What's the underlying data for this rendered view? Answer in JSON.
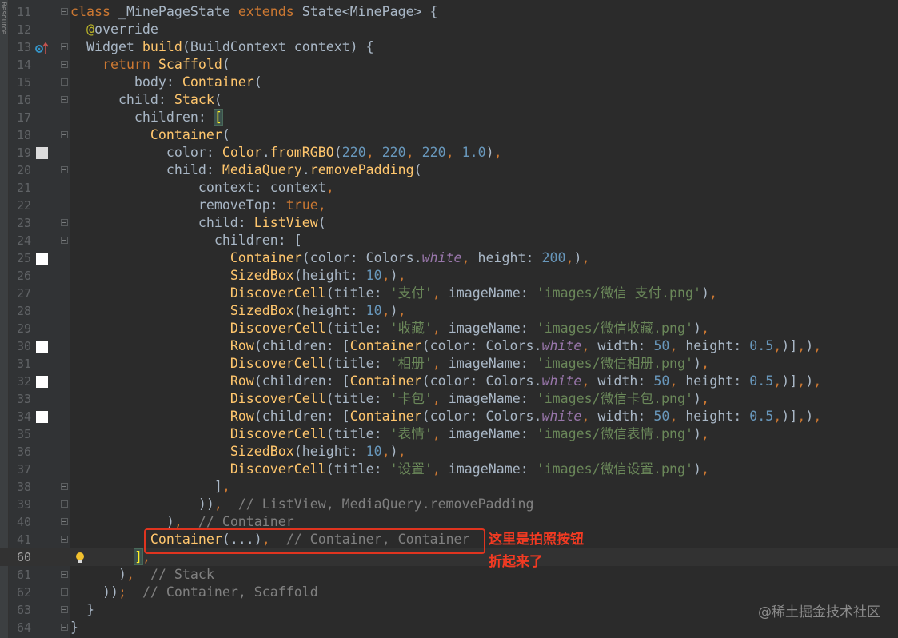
{
  "sidebar": {
    "tool_window_label": "Resource"
  },
  "colors": {
    "background": "#2b2b2b",
    "keyword": "#cc7832",
    "class": "#ffc66d",
    "string": "#6a8759",
    "number": "#6897bb",
    "comment": "#808080",
    "annotation_red": "#e0341f"
  },
  "lines": [
    {
      "n": "11",
      "fold": true,
      "tokens": [
        [
          "k",
          "class "
        ],
        [
          "t",
          "_MinePageState "
        ],
        [
          "k",
          "extends "
        ],
        [
          "t",
          "State<MinePage> {"
        ]
      ]
    },
    {
      "n": "12",
      "tokens": [
        [
          "t",
          "  "
        ],
        [
          "a",
          "@"
        ],
        [
          "t",
          "override"
        ]
      ]
    },
    {
      "n": "13",
      "fold": true,
      "icon": "override-method-icon",
      "tokens": [
        [
          "t",
          "  Widget "
        ],
        [
          "c",
          "build"
        ],
        [
          "t",
          "(BuildContext context) {"
        ]
      ]
    },
    {
      "n": "14",
      "fold": true,
      "tokens": [
        [
          "t",
          "    "
        ],
        [
          "k",
          "return "
        ],
        [
          "c",
          "Scaffold"
        ],
        [
          "t",
          "("
        ]
      ]
    },
    {
      "n": "15",
      "fold": true,
      "tokens": [
        [
          "t",
          "        body: "
        ],
        [
          "c",
          "Container"
        ],
        [
          "t",
          "("
        ]
      ]
    },
    {
      "n": "16",
      "fold": true,
      "tokens": [
        [
          "t",
          "      child: "
        ],
        [
          "c",
          "Stack"
        ],
        [
          "t",
          "("
        ]
      ]
    },
    {
      "n": "17",
      "tokens": [
        [
          "t",
          "        children: "
        ],
        [
          "b",
          "["
        ]
      ]
    },
    {
      "n": "18",
      "fold": true,
      "tokens": [
        [
          "t",
          "          "
        ],
        [
          "c",
          "Container"
        ],
        [
          "t",
          "("
        ]
      ]
    },
    {
      "n": "19",
      "swatch": "#dcdcdc",
      "tokens": [
        [
          "t",
          "            color: "
        ],
        [
          "c",
          "Color"
        ],
        [
          "t",
          "."
        ],
        [
          "c",
          "fromRGBO"
        ],
        [
          "t",
          "("
        ],
        [
          "n",
          "220"
        ],
        [
          "k",
          ", "
        ],
        [
          "n",
          "220"
        ],
        [
          "k",
          ", "
        ],
        [
          "n",
          "220"
        ],
        [
          "k",
          ", "
        ],
        [
          "n",
          "1.0"
        ],
        [
          "t",
          ")"
        ],
        [
          "k",
          ","
        ]
      ]
    },
    {
      "n": "20",
      "fold": true,
      "tokens": [
        [
          "t",
          "            child: "
        ],
        [
          "c",
          "MediaQuery"
        ],
        [
          "t",
          "."
        ],
        [
          "c",
          "removePadding"
        ],
        [
          "t",
          "("
        ]
      ]
    },
    {
      "n": "21",
      "tokens": [
        [
          "t",
          "                context: context"
        ],
        [
          "k",
          ","
        ]
      ]
    },
    {
      "n": "22",
      "tokens": [
        [
          "t",
          "                removeTop: "
        ],
        [
          "k",
          "true,"
        ]
      ]
    },
    {
      "n": "23",
      "fold": true,
      "tokens": [
        [
          "t",
          "                child: "
        ],
        [
          "c",
          "ListView"
        ],
        [
          "t",
          "("
        ]
      ]
    },
    {
      "n": "24",
      "fold": true,
      "tokens": [
        [
          "t",
          "                  children: ["
        ]
      ]
    },
    {
      "n": "25",
      "swatch": "#ffffff",
      "tokens": [
        [
          "t",
          "                    "
        ],
        [
          "c",
          "Container"
        ],
        [
          "t",
          "(color: Colors."
        ],
        [
          "p",
          "white"
        ],
        [
          "k",
          ", "
        ],
        [
          "t",
          "height: "
        ],
        [
          "n",
          "200"
        ],
        [
          "k",
          ","
        ],
        [
          "t",
          ")"
        ],
        [
          "k",
          ","
        ]
      ]
    },
    {
      "n": "26",
      "tokens": [
        [
          "t",
          "                    "
        ],
        [
          "c",
          "SizedBox"
        ],
        [
          "t",
          "(height: "
        ],
        [
          "n",
          "10"
        ],
        [
          "k",
          ","
        ],
        [
          "t",
          ")"
        ],
        [
          "k",
          ","
        ]
      ]
    },
    {
      "n": "27",
      "tokens": [
        [
          "t",
          "                    "
        ],
        [
          "c",
          "DiscoverCell"
        ],
        [
          "t",
          "(title: "
        ],
        [
          "s",
          "'支付'"
        ],
        [
          "k",
          ", "
        ],
        [
          "t",
          "imageName: "
        ],
        [
          "s",
          "'images/微信 支付.png'"
        ],
        [
          "t",
          ")"
        ],
        [
          "k",
          ","
        ]
      ]
    },
    {
      "n": "28",
      "tokens": [
        [
          "t",
          "                    "
        ],
        [
          "c",
          "SizedBox"
        ],
        [
          "t",
          "(height: "
        ],
        [
          "n",
          "10"
        ],
        [
          "k",
          ","
        ],
        [
          "t",
          ")"
        ],
        [
          "k",
          ","
        ]
      ]
    },
    {
      "n": "29",
      "tokens": [
        [
          "t",
          "                    "
        ],
        [
          "c",
          "DiscoverCell"
        ],
        [
          "t",
          "(title: "
        ],
        [
          "s",
          "'收藏'"
        ],
        [
          "k",
          ", "
        ],
        [
          "t",
          "imageName: "
        ],
        [
          "s",
          "'images/微信收藏.png'"
        ],
        [
          "t",
          ")"
        ],
        [
          "k",
          ","
        ]
      ]
    },
    {
      "n": "30",
      "swatch": "#ffffff",
      "tokens": [
        [
          "t",
          "                    "
        ],
        [
          "c",
          "Row"
        ],
        [
          "t",
          "(children: ["
        ],
        [
          "c",
          "Container"
        ],
        [
          "t",
          "(color: Colors."
        ],
        [
          "p",
          "white"
        ],
        [
          "k",
          ", "
        ],
        [
          "t",
          "width: "
        ],
        [
          "n",
          "50"
        ],
        [
          "k",
          ", "
        ],
        [
          "t",
          "height: "
        ],
        [
          "n",
          "0.5"
        ],
        [
          "k",
          ","
        ],
        [
          "t",
          ")]"
        ],
        [
          "k",
          ","
        ],
        [
          "t",
          ")"
        ],
        [
          "k",
          ","
        ]
      ]
    },
    {
      "n": "31",
      "tokens": [
        [
          "t",
          "                    "
        ],
        [
          "c",
          "DiscoverCell"
        ],
        [
          "t",
          "(title: "
        ],
        [
          "s",
          "'相册'"
        ],
        [
          "k",
          ", "
        ],
        [
          "t",
          "imageName: "
        ],
        [
          "s",
          "'images/微信相册.png'"
        ],
        [
          "t",
          ")"
        ],
        [
          "k",
          ","
        ]
      ]
    },
    {
      "n": "32",
      "swatch": "#ffffff",
      "tokens": [
        [
          "t",
          "                    "
        ],
        [
          "c",
          "Row"
        ],
        [
          "t",
          "(children: ["
        ],
        [
          "c",
          "Container"
        ],
        [
          "t",
          "(color: Colors."
        ],
        [
          "p",
          "white"
        ],
        [
          "k",
          ", "
        ],
        [
          "t",
          "width: "
        ],
        [
          "n",
          "50"
        ],
        [
          "k",
          ", "
        ],
        [
          "t",
          "height: "
        ],
        [
          "n",
          "0.5"
        ],
        [
          "k",
          ","
        ],
        [
          "t",
          ")]"
        ],
        [
          "k",
          ","
        ],
        [
          "t",
          ")"
        ],
        [
          "k",
          ","
        ]
      ]
    },
    {
      "n": "33",
      "tokens": [
        [
          "t",
          "                    "
        ],
        [
          "c",
          "DiscoverCell"
        ],
        [
          "t",
          "(title: "
        ],
        [
          "s",
          "'卡包'"
        ],
        [
          "k",
          ", "
        ],
        [
          "t",
          "imageName: "
        ],
        [
          "s",
          "'images/微信卡包.png'"
        ],
        [
          "t",
          ")"
        ],
        [
          "k",
          ","
        ]
      ]
    },
    {
      "n": "34",
      "swatch": "#ffffff",
      "tokens": [
        [
          "t",
          "                    "
        ],
        [
          "c",
          "Row"
        ],
        [
          "t",
          "(children: ["
        ],
        [
          "c",
          "Container"
        ],
        [
          "t",
          "(color: Colors."
        ],
        [
          "p",
          "white"
        ],
        [
          "k",
          ", "
        ],
        [
          "t",
          "width: "
        ],
        [
          "n",
          "50"
        ],
        [
          "k",
          ", "
        ],
        [
          "t",
          "height: "
        ],
        [
          "n",
          "0.5"
        ],
        [
          "k",
          ","
        ],
        [
          "t",
          ")]"
        ],
        [
          "k",
          ","
        ],
        [
          "t",
          ")"
        ],
        [
          "k",
          ","
        ]
      ]
    },
    {
      "n": "35",
      "tokens": [
        [
          "t",
          "                    "
        ],
        [
          "c",
          "DiscoverCell"
        ],
        [
          "t",
          "(title: "
        ],
        [
          "s",
          "'表情'"
        ],
        [
          "k",
          ", "
        ],
        [
          "t",
          "imageName: "
        ],
        [
          "s",
          "'images/微信表情.png'"
        ],
        [
          "t",
          ")"
        ],
        [
          "k",
          ","
        ]
      ]
    },
    {
      "n": "36",
      "tokens": [
        [
          "t",
          "                    "
        ],
        [
          "c",
          "SizedBox"
        ],
        [
          "t",
          "(height: "
        ],
        [
          "n",
          "10"
        ],
        [
          "k",
          ","
        ],
        [
          "t",
          ")"
        ],
        [
          "k",
          ","
        ]
      ]
    },
    {
      "n": "37",
      "tokens": [
        [
          "t",
          "                    "
        ],
        [
          "c",
          "DiscoverCell"
        ],
        [
          "t",
          "(title: "
        ],
        [
          "s",
          "'设置'"
        ],
        [
          "k",
          ", "
        ],
        [
          "t",
          "imageName: "
        ],
        [
          "s",
          "'images/微信设置.png'"
        ],
        [
          "t",
          ")"
        ],
        [
          "k",
          ","
        ]
      ]
    },
    {
      "n": "38",
      "fold": true,
      "tokens": [
        [
          "t",
          "                  ]"
        ],
        [
          "k",
          ","
        ]
      ]
    },
    {
      "n": "39",
      "fold": true,
      "tokens": [
        [
          "t",
          "                ))"
        ],
        [
          "k",
          ",  "
        ],
        [
          "m",
          "// ListView, MediaQuery.removePadding"
        ]
      ]
    },
    {
      "n": "40",
      "fold": true,
      "tokens": [
        [
          "t",
          "            )"
        ],
        [
          "k",
          ",  "
        ],
        [
          "m",
          "// Container"
        ]
      ]
    },
    {
      "n": "41",
      "fold": true,
      "tokens": [
        [
          "t",
          "          "
        ],
        [
          "c",
          "Container"
        ],
        [
          "t",
          "(...)"
        ],
        [
          "k",
          ",  "
        ],
        [
          "m",
          "// Container, Container"
        ]
      ]
    },
    {
      "n": "60",
      "current": true,
      "icon": "lightbulb-icon",
      "tokens": [
        [
          "t",
          "        "
        ],
        [
          "b",
          "]"
        ],
        [
          "k",
          ","
        ]
      ]
    },
    {
      "n": "61",
      "fold": true,
      "tokens": [
        [
          "t",
          "      )"
        ],
        [
          "k",
          ",  "
        ],
        [
          "m",
          "// Stack"
        ]
      ]
    },
    {
      "n": "62",
      "fold": true,
      "tokens": [
        [
          "t",
          "    ))"
        ],
        [
          "k",
          ";  "
        ],
        [
          "m",
          "// Container, Scaffold"
        ]
      ]
    },
    {
      "n": "63",
      "fold": true,
      "tokens": [
        [
          "t",
          "  }"
        ]
      ]
    },
    {
      "n": "64",
      "fold": true,
      "tokens": [
        [
          "t",
          "}"
        ]
      ]
    }
  ],
  "annotation": {
    "line1": "这里是拍照按钮",
    "line2": "折起来了"
  },
  "watermark": "@稀土掘金技术社区"
}
